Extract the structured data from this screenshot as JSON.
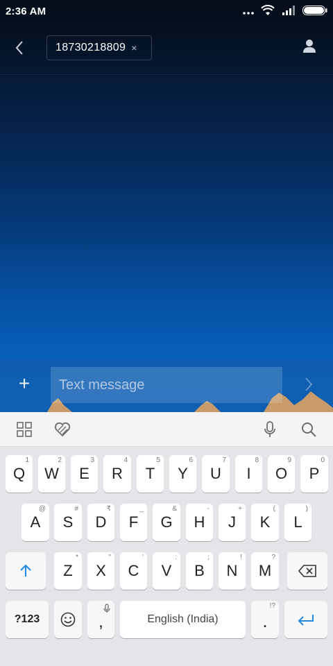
{
  "status_bar": {
    "time": "2:36 AM"
  },
  "header": {
    "recipient_number": "18730218809",
    "recipient_remove": "×"
  },
  "compose": {
    "placeholder": "Text message",
    "add_label": "+"
  },
  "keyboard": {
    "row1": [
      {
        "label": "Q",
        "hint": "1"
      },
      {
        "label": "W",
        "hint": "2"
      },
      {
        "label": "E",
        "hint": "3"
      },
      {
        "label": "R",
        "hint": "4"
      },
      {
        "label": "T",
        "hint": "5"
      },
      {
        "label": "Y",
        "hint": "6"
      },
      {
        "label": "U",
        "hint": "7"
      },
      {
        "label": "I",
        "hint": "8"
      },
      {
        "label": "O",
        "hint": "9"
      },
      {
        "label": "P",
        "hint": "0"
      }
    ],
    "row2": [
      {
        "label": "A",
        "hint": "@"
      },
      {
        "label": "S",
        "hint": "#"
      },
      {
        "label": "D",
        "hint": "₹"
      },
      {
        "label": "F",
        "hint": "_"
      },
      {
        "label": "G",
        "hint": "&"
      },
      {
        "label": "H",
        "hint": "-"
      },
      {
        "label": "J",
        "hint": "+"
      },
      {
        "label": "K",
        "hint": "("
      },
      {
        "label": "L",
        "hint": ")"
      }
    ],
    "row3": [
      {
        "label": "Z",
        "hint": "*"
      },
      {
        "label": "X",
        "hint": "\""
      },
      {
        "label": "C",
        "hint": "'"
      },
      {
        "label": "V",
        "hint": ":"
      },
      {
        "label": "B",
        "hint": ";"
      },
      {
        "label": "N",
        "hint": "!"
      },
      {
        "label": "M",
        "hint": "?"
      }
    ],
    "symbols_label": "?123",
    "comma_label": ",",
    "space_label": "English (India)",
    "period_label": ".",
    "period_hint": "!?"
  },
  "colors": {
    "accent": "#1e88e5",
    "keyboard_bg": "#e4e5e8"
  }
}
